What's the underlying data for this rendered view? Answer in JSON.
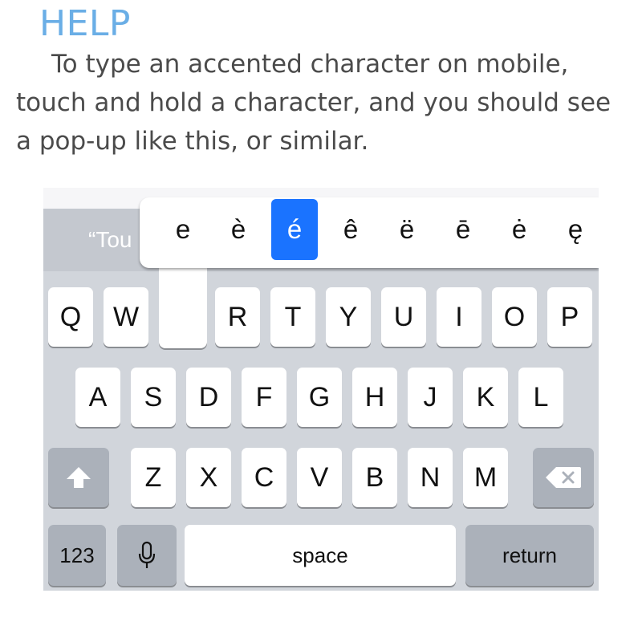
{
  "help": {
    "title": "HELP",
    "text": "To type an accented character on mobile, touch and hold a character, and you should see a pop-up like this, or similar."
  },
  "keyboard": {
    "suggestion_text": "“Tou",
    "accent_options": [
      "e",
      "è",
      "é",
      "ê",
      "ë",
      "ē",
      "ė",
      "ę"
    ],
    "selected_accent": "é",
    "row1": [
      "Q",
      "W",
      "",
      "R",
      "T",
      "Y",
      "U",
      "I",
      "O",
      "P"
    ],
    "row2": [
      "A",
      "S",
      "D",
      "F",
      "G",
      "H",
      "J",
      "K",
      "L"
    ],
    "row3": [
      "Z",
      "X",
      "C",
      "V",
      "B",
      "N",
      "M"
    ],
    "numbers_label": "123",
    "space_label": "space",
    "return_label": "return",
    "icons": {
      "shift": "shift-arrow-icon",
      "delete": "backspace-icon",
      "mic": "microphone-icon"
    },
    "colors": {
      "selected": "#1a73ff",
      "keyboard_bg": "#d1d5db",
      "dark_key": "#abb1ba",
      "title": "#6aaee6"
    }
  }
}
